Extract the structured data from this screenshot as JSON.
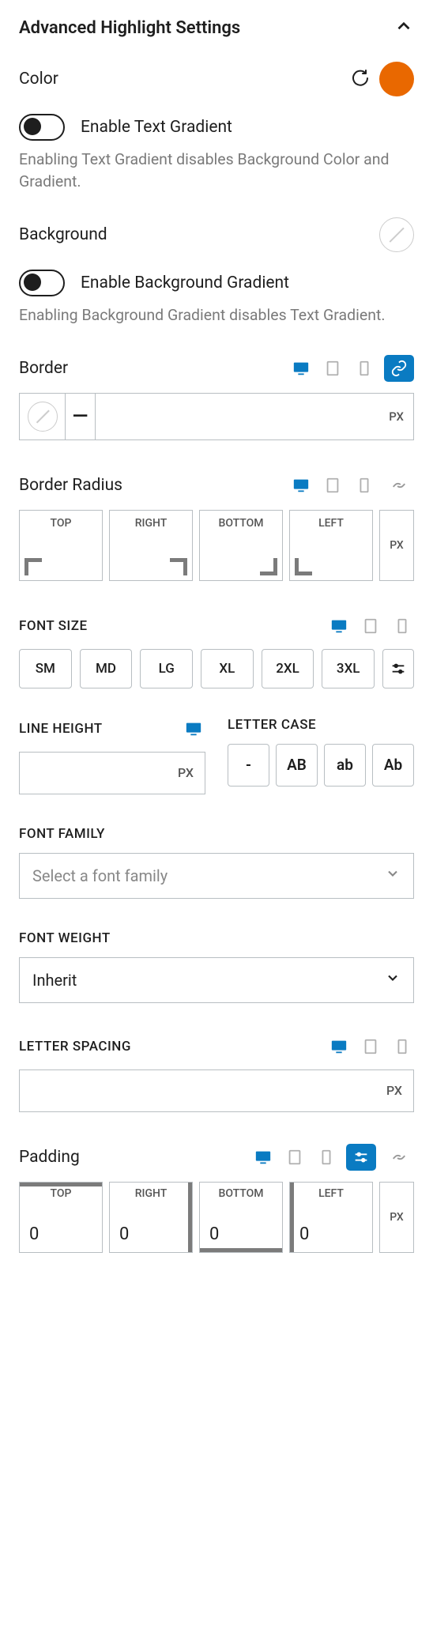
{
  "panel": {
    "title": "Advanced Highlight Settings"
  },
  "color": {
    "label": "Color",
    "swatch": "#e96800"
  },
  "textGradient": {
    "label": "Enable Text Gradient",
    "helper": "Enabling Text Gradient disables Background Color and Gradient.",
    "enabled": false
  },
  "background": {
    "label": "Background"
  },
  "bgGradient": {
    "label": "Enable Background Gradient",
    "helper": "Enabling Background Gradient disables Text Gradient.",
    "enabled": false
  },
  "border": {
    "label": "Border",
    "styleGlyph": "—",
    "unit": "PX"
  },
  "borderRadius": {
    "label": "Border Radius",
    "sides": [
      "TOP",
      "RIGHT",
      "BOTTOM",
      "LEFT"
    ],
    "unit": "PX"
  },
  "fontSize": {
    "label": "FONT SIZE",
    "presets": [
      "SM",
      "MD",
      "LG",
      "XL",
      "2XL",
      "3XL"
    ]
  },
  "lineHeight": {
    "label": "LINE HEIGHT",
    "unit": "PX"
  },
  "letterCase": {
    "label": "LETTER CASE",
    "options": [
      "-",
      "AB",
      "ab",
      "Ab"
    ]
  },
  "fontFamily": {
    "label": "FONT FAMILY",
    "placeholder": "Select a font family"
  },
  "fontWeight": {
    "label": "FONT WEIGHT",
    "value": "Inherit"
  },
  "letterSpacing": {
    "label": "LETTER SPACING",
    "unit": "PX"
  },
  "padding": {
    "label": "Padding",
    "sides": [
      "TOP",
      "RIGHT",
      "BOTTOM",
      "LEFT"
    ],
    "values": [
      "0",
      "0",
      "0",
      "0"
    ],
    "unit": "PX"
  }
}
